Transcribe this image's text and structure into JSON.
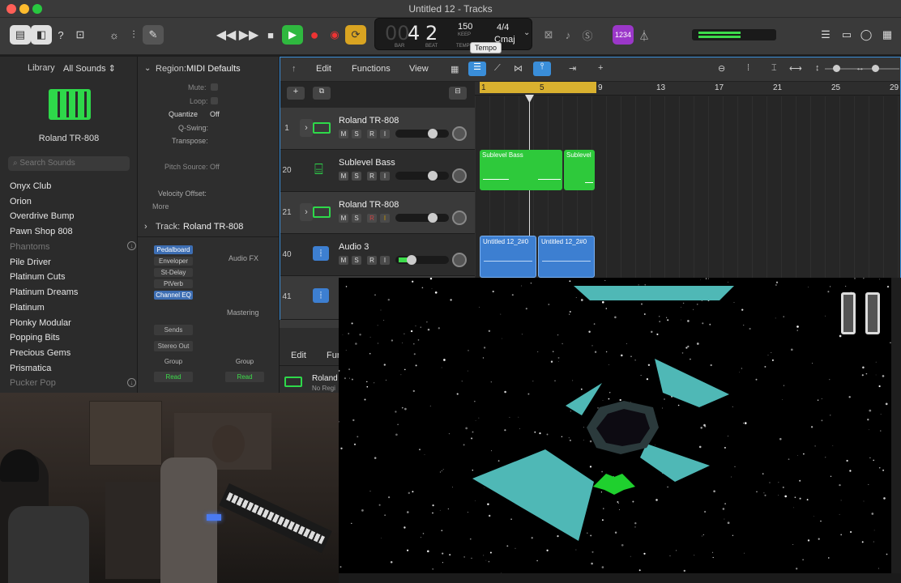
{
  "window": {
    "title": "Untitled 12 - Tracks"
  },
  "transport": {
    "bar": "4",
    "beat": "2",
    "tempo": "150",
    "time_sig": "4/4",
    "key": "Cmaj",
    "lbl_bar": "BAR",
    "lbl_beat": "BEAT",
    "lbl_keep": "KEEP",
    "lbl_tempo": "TEMPO",
    "tooltip": "Tempo",
    "count_in": "1234"
  },
  "library": {
    "title": "Library",
    "filter": "All Sounds ⇕",
    "selected_patch": "Roland TR-808",
    "search_placeholder": "Search Sounds",
    "items": [
      {
        "label": "Onyx Club"
      },
      {
        "label": "Orion"
      },
      {
        "label": "Overdrive Bump"
      },
      {
        "label": "Pawn Shop 808"
      },
      {
        "label": "Phantoms"
      },
      {
        "label": "Pile Driver"
      },
      {
        "label": "Platinum Cuts"
      },
      {
        "label": "Platinum Dreams"
      },
      {
        "label": "Platinum"
      },
      {
        "label": "Plonky Modular"
      },
      {
        "label": "Popping Bits"
      },
      {
        "label": "Precious Gems"
      },
      {
        "label": "Prismatica"
      },
      {
        "label": "Pucker Pop"
      }
    ]
  },
  "inspector": {
    "region_label": "Region:",
    "region_name": "MIDI Defaults",
    "mute": "Mute:",
    "loop": "Loop:",
    "quantize": "Quantize",
    "quantize_val": "Off",
    "qswing": "Q-Swing:",
    "transpose": "Transpose:",
    "pitch_source": "Pitch Source:",
    "pitch_val": "Off",
    "velocity": "Velocity Offset:",
    "more": "More",
    "track_label": "Track:",
    "track_name": "Roland TR-808",
    "plugins": [
      {
        "label": "Pedalboard"
      },
      {
        "label": "Enveloper"
      },
      {
        "label": "St-Delay"
      },
      {
        "label": "PtVerb"
      },
      {
        "label": "Channel EQ"
      }
    ],
    "audio_fx": "Audio FX",
    "mastering": "Mastering",
    "sends": "Sends",
    "stereo_out": "Stereo Out",
    "group": "Group",
    "read": "Read"
  },
  "trackarea": {
    "menus": {
      "edit": "Edit",
      "functions": "Functions",
      "view": "View"
    },
    "ruler": [
      "1",
      "5",
      "9",
      "13",
      "17",
      "21",
      "25",
      "29"
    ],
    "tracks": [
      {
        "num": "1",
        "name": "Roland TR-808"
      },
      {
        "num": "20",
        "name": "Sublevel Bass"
      },
      {
        "num": "21",
        "name": "Roland TR-808"
      },
      {
        "num": "40",
        "name": "Audio 3"
      },
      {
        "num": "41",
        "name": ""
      }
    ],
    "regions": {
      "sublevel_a": "Sublevel Bass",
      "sublevel_b": "Sublevel",
      "audio_a": "Untitled 12_2#0",
      "audio_b": "Untitled 12_2#0"
    },
    "msri": {
      "m": "M",
      "s": "S",
      "r": "R",
      "i": "I"
    }
  },
  "editpanel": {
    "edit": "Edit",
    "fun": "Fur",
    "track": "Roland",
    "sub": "No Regi"
  },
  "colors": {
    "accent_blue": "#3a8ed9",
    "green_region": "#2ec93b",
    "audio_region": "#3d7fd1",
    "game_teal": "#4fb8b6"
  }
}
